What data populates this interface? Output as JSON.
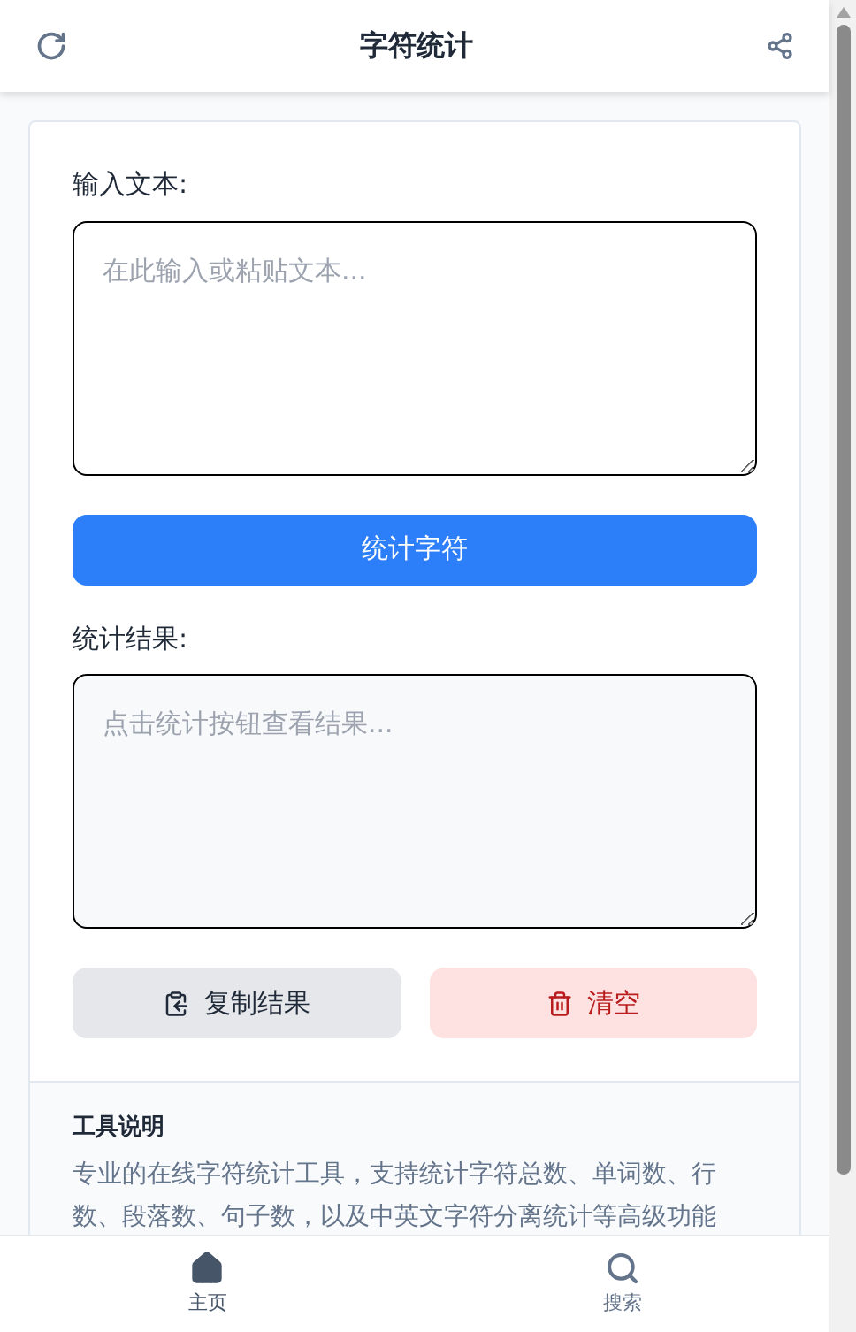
{
  "header": {
    "title": "字符统计"
  },
  "input": {
    "label": "输入文本:",
    "placeholder": "在此输入或粘贴文本..."
  },
  "count_button": "统计字符",
  "result": {
    "label": "统计结果:",
    "placeholder": "点击统计按钮查看结果..."
  },
  "actions": [
    {
      "kind": "copy",
      "label": "复制结果"
    },
    {
      "kind": "clear",
      "label": "清空"
    }
  ],
  "info": {
    "title": "工具说明",
    "text": "专业的在线字符统计工具，支持统计字符总数、单词数、行数、段落数、句子数，以及中英文字符分离统计等高级功能"
  },
  "nav": [
    {
      "kind": "home",
      "label": "主页",
      "selected": true
    },
    {
      "kind": "search",
      "label": "搜索",
      "selected": false
    }
  ]
}
